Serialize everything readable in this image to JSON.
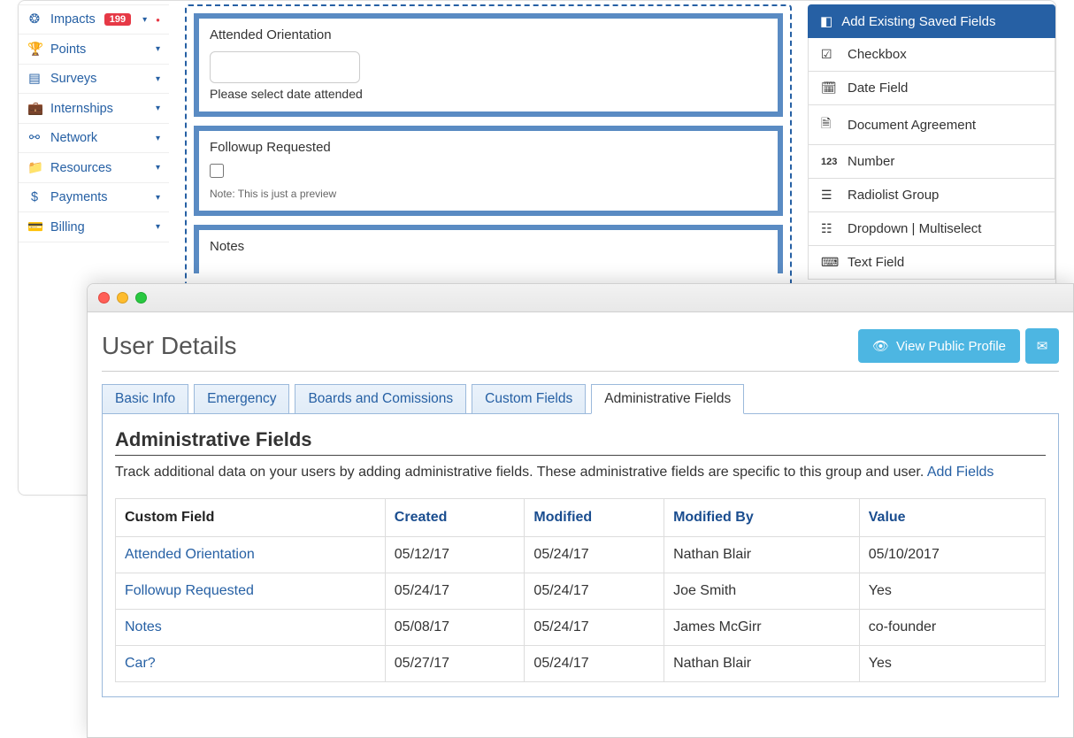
{
  "sidebar": {
    "items": [
      {
        "label": "Impacts",
        "badge": "199"
      },
      {
        "label": "Points"
      },
      {
        "label": "Surveys"
      },
      {
        "label": "Internships"
      },
      {
        "label": "Network"
      },
      {
        "label": "Resources"
      },
      {
        "label": "Payments"
      },
      {
        "label": "Billing"
      }
    ]
  },
  "form_preview": {
    "block1": {
      "title": "Attended Orientation",
      "helper": "Please select date attended"
    },
    "block2": {
      "title": "Followup Requested",
      "note": "Note: This is just a preview"
    },
    "block3": {
      "title": "Notes"
    }
  },
  "palette": {
    "header": "Add Existing Saved Fields",
    "items": [
      "Checkbox",
      "Date Field",
      "Document Agreement",
      "Number",
      "Radiolist Group",
      "Dropdown | Multiselect",
      "Text Field"
    ]
  },
  "window": {
    "page_title": "User Details",
    "view_profile_btn": "View Public Profile",
    "tabs": [
      "Basic Info",
      "Emergency",
      "Boards and Comissions",
      "Custom Fields",
      "Administrative Fields"
    ],
    "panel_title": "Administrative Fields",
    "panel_desc": "Track additional data on your users by adding administrative fields. These administrative fields are specific to this group and user. ",
    "add_fields_link": "Add Fields",
    "table": {
      "headers": [
        "Custom Field",
        "Created",
        "Modified",
        "Modified By",
        "Value"
      ],
      "rows": [
        {
          "name": "Attended Orientation",
          "created": "05/12/17",
          "modified": "05/24/17",
          "by": "Nathan Blair",
          "value": "05/10/2017"
        },
        {
          "name": "Followup Requested",
          "created": "05/24/17",
          "modified": "05/24/17",
          "by": "Joe Smith",
          "value": "Yes"
        },
        {
          "name": "Notes",
          "created": "05/08/17",
          "modified": "05/24/17",
          "by": "James McGirr",
          "value": "co-founder"
        },
        {
          "name": "Car?",
          "created": "05/27/17",
          "modified": "05/24/17",
          "by": "Nathan Blair",
          "value": "Yes"
        }
      ]
    }
  }
}
